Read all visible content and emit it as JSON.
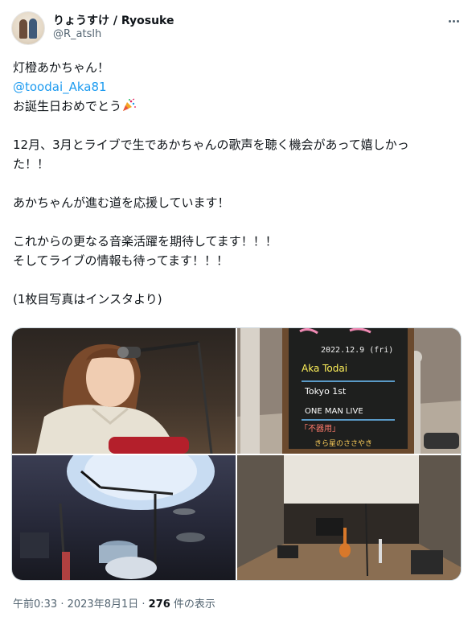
{
  "user": {
    "display_name": "りょうすけ / Ryosuke",
    "handle": "@R_atslh"
  },
  "tweet": {
    "line1": "灯橙あかちゃん！",
    "mention": "@toodai_Aka81",
    "line3": "お誕生日おめでとう",
    "para2_line1": "12月、3月とライブで生であかちゃんの歌声を聴く機会があって嬉しかっ",
    "para2_line2": "た！！",
    "para3": "あかちゃんが進む道を応援しています！",
    "para4_line1": "これからの更なる音楽活躍を期待してます！！！",
    "para4_line2": "そしてライブの情報も待ってます！！！",
    "para5": "(1枚目写真はインスタより)"
  },
  "photo2_board": {
    "date": "2022.12.9 (fri)",
    "artist": "Aka Todai",
    "tour": "Tokyo 1st",
    "event": "ONE MAN LIVE",
    "jp1": "「不器用」",
    "jp2": "きら星のささやき"
  },
  "footer": {
    "time": "午前0:33",
    "sep1": " · ",
    "date": "2023年8月1日",
    "sep2": " · ",
    "views_count": "276",
    "views_label": " 件の表示"
  },
  "icons": {
    "more": "more-icon",
    "party": "party-popper-icon"
  }
}
